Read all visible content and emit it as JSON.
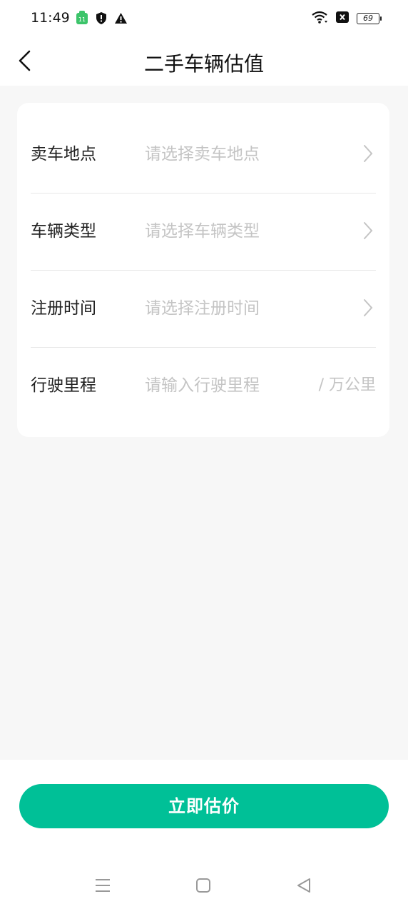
{
  "status_bar": {
    "time": "11:49",
    "battery": "69",
    "icons": [
      "app-badge-icon",
      "shield-icon",
      "warning-icon",
      "wifi-icon",
      "close-box-icon",
      "battery-icon"
    ]
  },
  "header": {
    "title": "二手车辆估值",
    "back_icon": "chevron-left-icon"
  },
  "form": {
    "rows": [
      {
        "label": "卖车地点",
        "placeholder": "请选择卖车地点",
        "type": "select"
      },
      {
        "label": "车辆类型",
        "placeholder": "请选择车辆类型",
        "type": "select"
      },
      {
        "label": "注册时间",
        "placeholder": "请选择注册时间",
        "type": "select"
      },
      {
        "label": "行驶里程",
        "placeholder": "请输入行驶里程",
        "type": "input",
        "unit": "/ 万公里"
      }
    ]
  },
  "footer": {
    "submit_label": "立即估价"
  },
  "colors": {
    "accent": "#00c097",
    "background": "#f7f7f7",
    "placeholder": "#c4c4c4"
  }
}
